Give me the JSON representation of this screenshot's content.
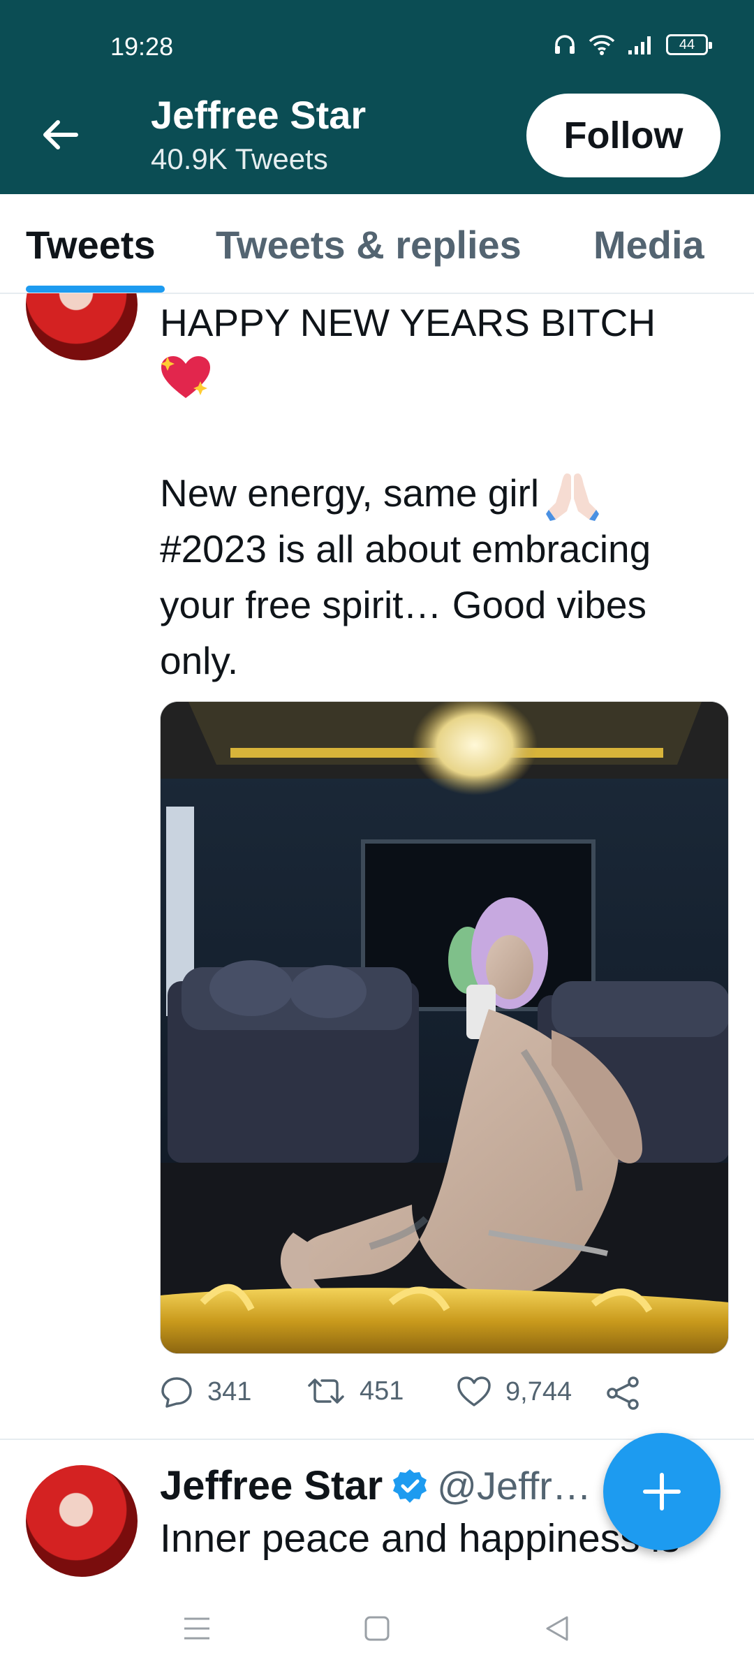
{
  "status_bar": {
    "time": "19:28",
    "battery": "44"
  },
  "header": {
    "name": "Jeffree Star",
    "tweet_count": "40.9K Tweets",
    "follow_label": "Follow",
    "background_color": "#0b4d54"
  },
  "tabs": [
    {
      "label": "Tweets",
      "active": true
    },
    {
      "label": "Tweets & replies",
      "active": false
    },
    {
      "label": "Media",
      "active": false
    }
  ],
  "tweet1": {
    "line1": "HAPPY NEW YEARS BITCH",
    "emoji_after_line1": "sparkling-heart",
    "paragraph_lines": [
      "New energy, same girl",
      "#2023 is all about embracing",
      "your free spirit… Good vibes",
      "only."
    ],
    "emoji_after_paragraph_line1": "folded-hands",
    "media": "photo",
    "replies": "341",
    "retweets": "451",
    "likes": "9,744"
  },
  "tweet2": {
    "name": "Jeffree Star",
    "verified": true,
    "handle": "@Jeffr…",
    "text": "Inner peace and happiness is"
  },
  "accent_color": "#1d9bf0"
}
